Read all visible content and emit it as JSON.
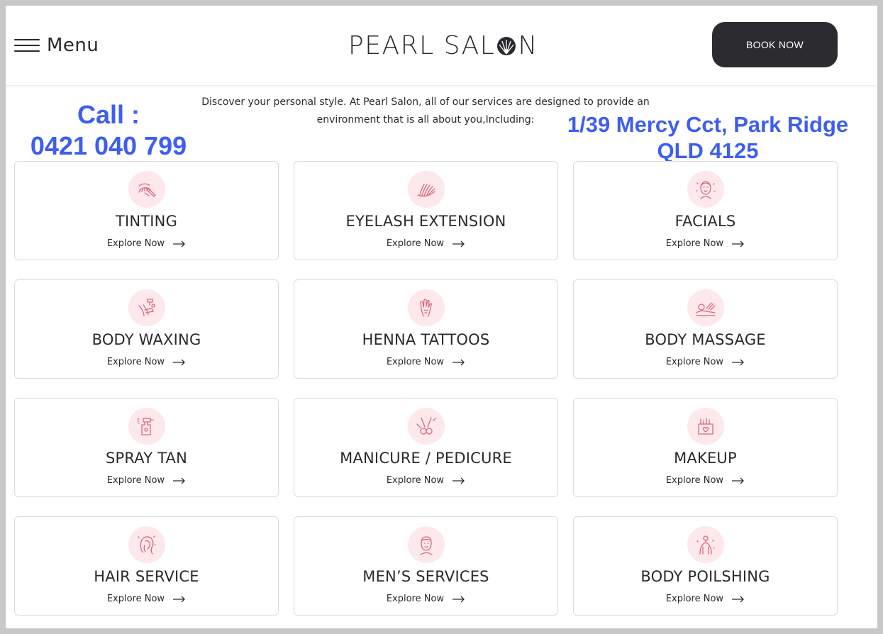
{
  "header": {
    "menu_label": "Menu",
    "logo_text_left": "PEARL SAL",
    "logo_text_right": "N",
    "book_button": "BOOK NOW"
  },
  "intro": {
    "line1": "Discover your personal style. At Pearl Salon, all of our services are designed to provide an",
    "line2": "environment that is all about you,Including:"
  },
  "overlay": {
    "call_label": "Call :",
    "phone": "0421 040 799",
    "address_line1": "1/39 Mercy Cct, Park Ridge",
    "address_line2": "QLD 4125"
  },
  "colors": {
    "accent_text": "#3e5ef0",
    "icon_bg": "#fde8ec",
    "icon_stroke": "#d9687e",
    "button_bg": "#2c2b30"
  },
  "services": [
    {
      "title": "TINTING",
      "link": "Explore Now",
      "icon": "brow-tint-icon"
    },
    {
      "title": "EYELASH EXTENSION",
      "link": "Explore Now",
      "icon": "eyelash-icon"
    },
    {
      "title": "FACIALS",
      "link": "Explore Now",
      "icon": "face-icon"
    },
    {
      "title": "BODY WAXING",
      "link": "Explore Now",
      "icon": "waxing-icon"
    },
    {
      "title": "HENNA TATTOOS",
      "link": "Explore Now",
      "icon": "henna-hand-icon"
    },
    {
      "title": "BODY MASSAGE",
      "link": "Explore Now",
      "icon": "massage-icon"
    },
    {
      "title": "SPRAY TAN",
      "link": "Explore Now",
      "icon": "spray-bottle-icon"
    },
    {
      "title": "MANICURE / PEDICURE",
      "link": "Explore Now",
      "icon": "nail-clipper-icon"
    },
    {
      "title": "MAKEUP",
      "link": "Explore Now",
      "icon": "makeup-box-icon"
    },
    {
      "title": "HAIR SERVICE",
      "link": "Explore Now",
      "icon": "hair-icon"
    },
    {
      "title": "MEN’S SERVICES",
      "link": "Explore Now",
      "icon": "man-face-icon"
    },
    {
      "title": "BODY POILSHING",
      "link": "Explore Now",
      "icon": "body-polish-icon"
    }
  ]
}
